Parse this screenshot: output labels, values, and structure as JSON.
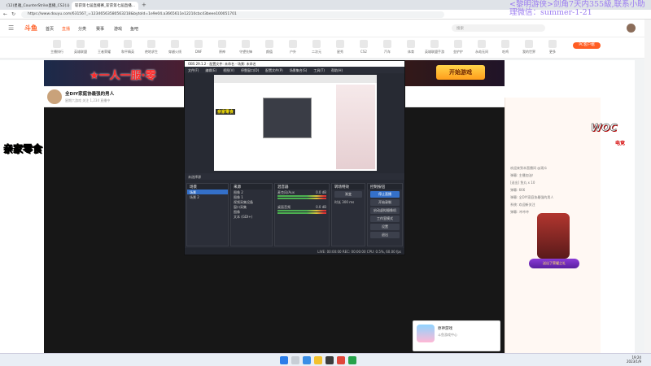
{
  "browser": {
    "tabs": [
      {
        "label": "(12)星雅_CounterStrike直播_CS2(斗鱼..."
      },
      {
        "label": "斩获第七届直播赛_斩获第七届直播..."
      }
    ],
    "url": "https://www.douyu.com/631567_=12346563580563218&bytoId=1e9e04.a3665611e12210cbc43beee100051701"
  },
  "site": {
    "logo": "斗鱼",
    "nav": [
      "首页",
      "直播",
      "分类",
      "赛事",
      "游戏",
      "鱼吧"
    ],
    "search_placeholder": "搜索",
    "pc_button": "PC客户端",
    "categories": [
      "主播排行",
      "英雄联盟",
      "王者荣耀",
      "和平精英",
      "绝地求生",
      "穿越火线",
      "DNF",
      "原神",
      "守望先锋",
      "颜值",
      "户外",
      "二次元",
      "星秀",
      "CS2",
      "汽车",
      "体育",
      "英雄联盟手游",
      "金铲铲",
      "永劫无间",
      "吃鸡",
      "我的世界",
      "更多"
    ]
  },
  "banner": {
    "title": "★一人一服·零",
    "start_button": "开始游戏"
  },
  "room": {
    "title": "全DIY家庭协最强的男人",
    "meta": "星期六游戏  关注 1,234  直播中"
  },
  "caption": "亲家零食",
  "watermark": "<黎明游侠>剑角7天内355級,联系小助理微信：summer-1-21",
  "woc": {
    "logo": "WOC",
    "sub": "电竞"
  },
  "chat": {
    "lines": [
      "欢迎来到本直播间 @观众",
      "弹幕: 主播加油！",
      "[送出] 鱼丸 x 10",
      "弹幕: 666",
      "弹幕: 全DIY家庭协最强的男人",
      "系统: 欢迎新关注",
      "弹幕: 冲冲冲"
    ],
    "gift_text": "送出了荣耀之礼"
  },
  "obs": {
    "title": "OBS 29.1.2 - 配置文件: 未命名 - 场景: 未命名",
    "menu": [
      "文件(F)",
      "编辑(E)",
      "视图(V)",
      "停靠窗口(D)",
      "配置文件(P)",
      "场景集合(S)",
      "工具(T)",
      "帮助(H)"
    ],
    "preview_tag": "亲家零食",
    "bar_text": "未选择源",
    "panels": {
      "scenes": {
        "title": "场景",
        "items": [
          "场景",
          "场景 2"
        ]
      },
      "sources": {
        "title": "来源",
        "items": [
          "图像 2",
          "图像 1",
          "视频采集设备",
          "窗口采集",
          "图像",
          "文本 (GDI+)"
        ]
      },
      "mixer": {
        "title": "混音器",
        "items": [
          "麦克风/Aux",
          "桌面音频"
        ],
        "levels": [
          "0.0 dB",
          "0.0 dB"
        ]
      },
      "transitions": {
        "title": "转场特效",
        "items": [
          "渐变",
          "时长",
          "300 ms"
        ]
      },
      "controls": {
        "title": "控制按钮",
        "buttons": [
          "停止直播",
          "开始录制",
          "启动虚拟摄像机",
          "工作室模式",
          "设置",
          "退出"
        ]
      }
    },
    "status": "LIVE: 00:00:00   REC: 00:00:00   CPU: 0.5%, 60.00 fps"
  },
  "app_card": {
    "title": "原神游戏",
    "subtitle": "斗鱼游戏中心"
  },
  "taskbar": {
    "time": "19:24",
    "date": "2023/1/9"
  }
}
